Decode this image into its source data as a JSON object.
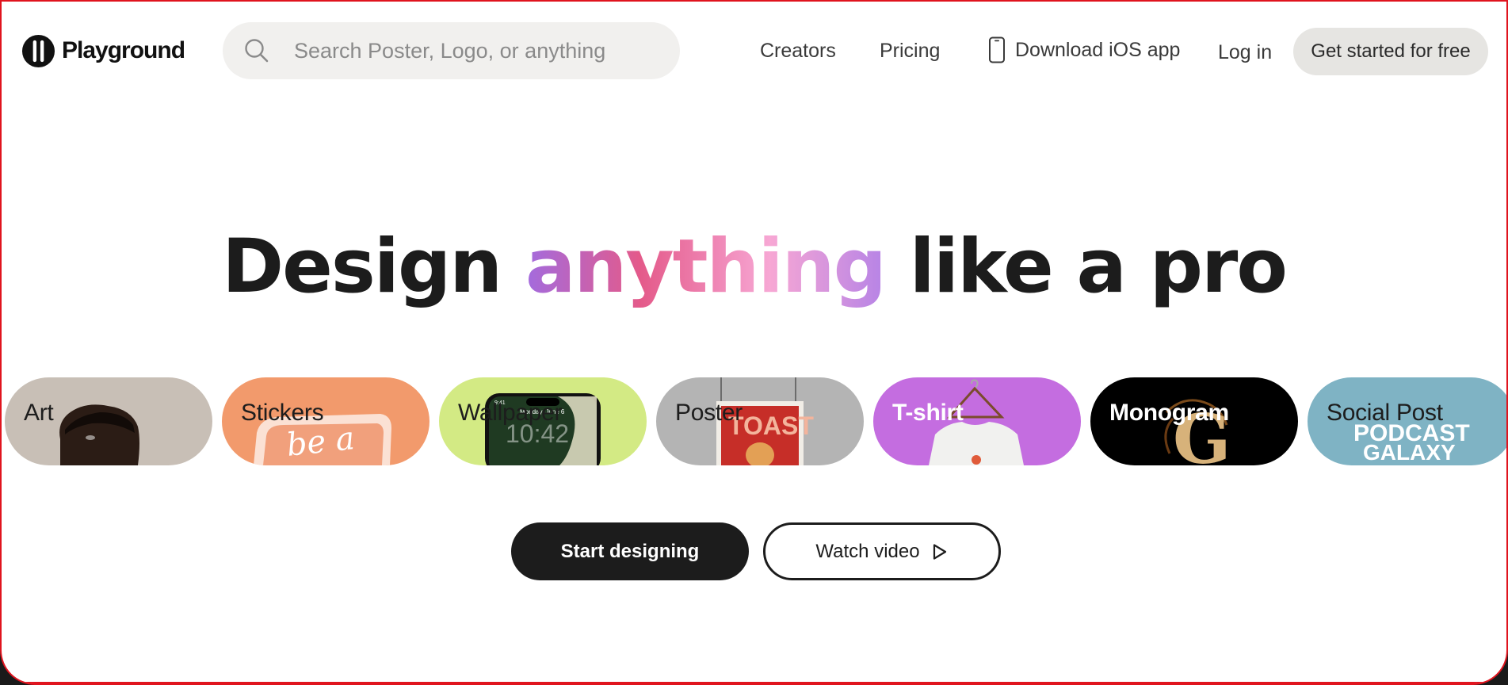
{
  "brand": {
    "name": "Playground"
  },
  "search": {
    "placeholder": "Search Poster, Logo, or anything"
  },
  "nav": {
    "creators": "Creators",
    "pricing": "Pricing",
    "download_ios": "Download iOS app",
    "login": "Log in",
    "get_started": "Get started for free"
  },
  "hero": {
    "title_before": "Design",
    "title_highlight": "anything",
    "title_after": "like a pro"
  },
  "categories": [
    {
      "label": "Art",
      "color": "#c8bfb6"
    },
    {
      "label": "Stickers",
      "color": "#f29a6c"
    },
    {
      "label": "Wallpaper",
      "color": "#d3ea84"
    },
    {
      "label": "Poster",
      "color": "#b4b4b4"
    },
    {
      "label": "T-shirt",
      "color": "#c46de0"
    },
    {
      "label": "Monogram",
      "color": "#000000"
    },
    {
      "label": "Social Post",
      "color": "#7fb3c4"
    }
  ],
  "pill_art_text": {
    "stickers": "be a",
    "wallpaper_clock": "10:42",
    "wallpaper_date": "Monday, June 6",
    "wallpaper_status": "9:41",
    "poster": "TOAST",
    "monogram": "G",
    "social_line1": "PODCAST",
    "social_line2": "GALAXY"
  },
  "actions": {
    "start_designing": "Start designing",
    "watch_video": "Watch video"
  },
  "colors": {
    "accent_dark": "#1c1c1c",
    "border_red": "#e0141e",
    "search_bg": "#f1f0ee"
  }
}
